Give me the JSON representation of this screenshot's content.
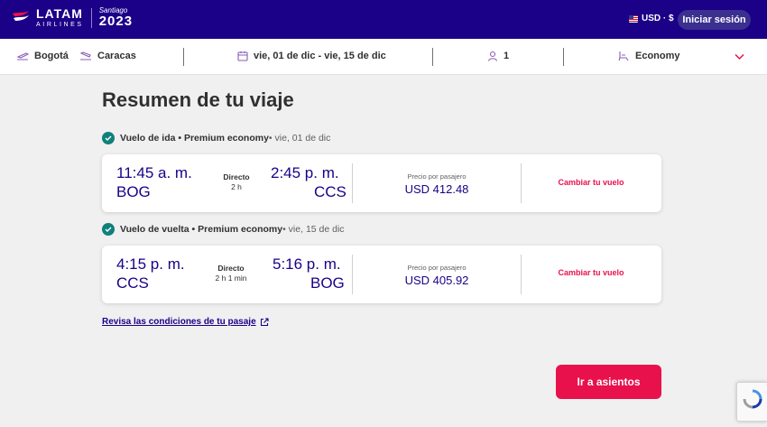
{
  "header": {
    "brand": "LATAM",
    "brand_sub": "AIRLINES",
    "event_city": "Santiago",
    "event_year": "2023",
    "currency": "USD · $",
    "login_label": "Iniciar sesión"
  },
  "search": {
    "origin": "Bogotá",
    "destination": "Caracas",
    "dates": "vie, 01 de dic - vie, 15 de dic",
    "passengers": "1",
    "cabin": "Economy"
  },
  "page_title": "Resumen de tu viaje",
  "outbound": {
    "label_bold": "Vuelo de ida • Premium economy",
    "label_date": " • vie, 01 de dic",
    "dep_time": "11:45 a. m.",
    "dep_code": "BOG",
    "stops": "Directo",
    "duration": "2 h",
    "arr_time": "2:45 p. m.",
    "arr_code": "CCS",
    "price_label": "Precio por pasajero",
    "price": "USD 412.48",
    "change_label": "Cambiar tu vuelo"
  },
  "return": {
    "label_bold": "Vuelo de vuelta • Premium economy",
    "label_date": " • vie, 15 de dic",
    "dep_time": "4:15 p. m.",
    "dep_code": "CCS",
    "stops": "Directo",
    "duration": "2 h 1 min",
    "arr_time": "5:16 p. m.",
    "arr_code": "BOG",
    "price_label": "Precio por pasajero",
    "price": "USD 405.92",
    "change_label": "Cambiar tu vuelo"
  },
  "terms_link": "Revisa las condiciones de tu pasaje",
  "cta_label": "Ir a asientos",
  "colors": {
    "brand_indigo": "#1b0088",
    "accent_red": "#e8114b",
    "check_teal": "#10807a"
  }
}
